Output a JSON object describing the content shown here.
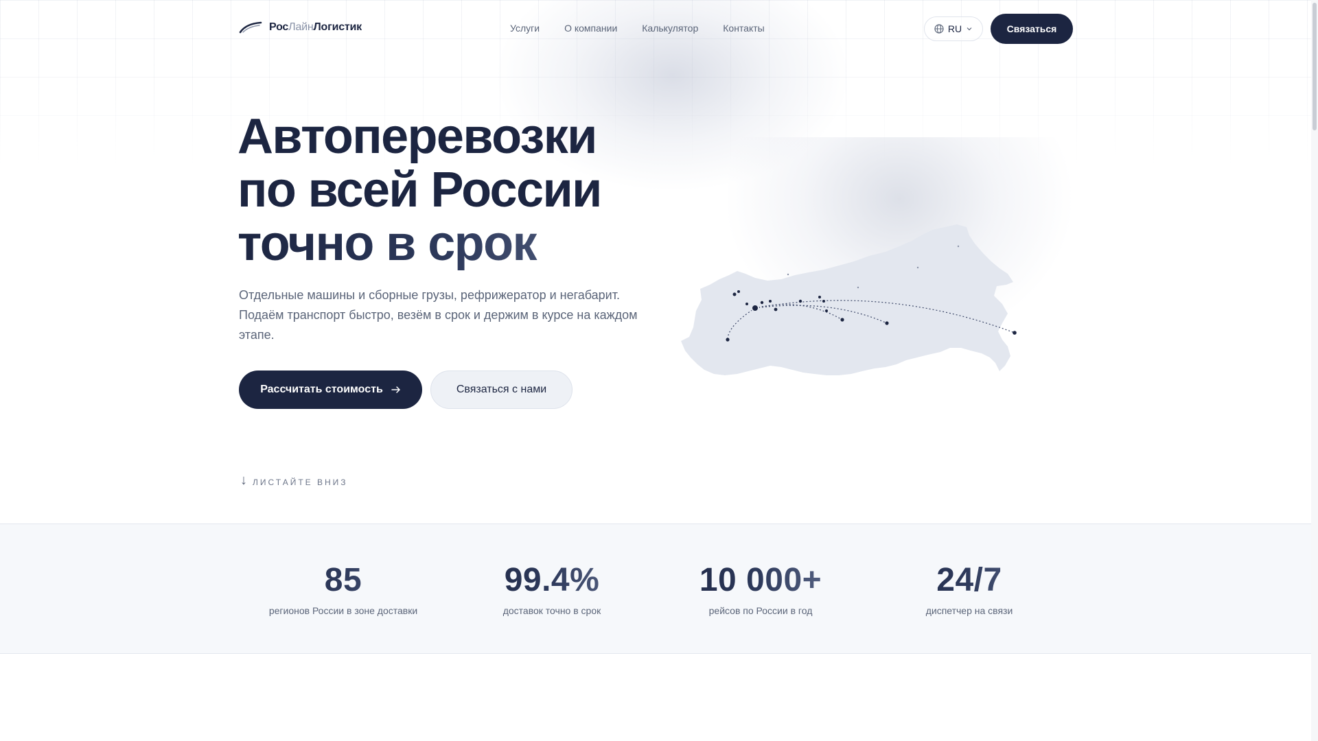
{
  "logo": {
    "part1": "Рос",
    "part2": "Лайн",
    "part3": "Логистик"
  },
  "nav": {
    "items": [
      {
        "label": "Услуги"
      },
      {
        "label": "О компании"
      },
      {
        "label": "Калькулятор"
      },
      {
        "label": "Контакты"
      }
    ]
  },
  "header": {
    "lang": "RU",
    "lang_icon": "globe-icon",
    "cta": "Связаться"
  },
  "hero": {
    "title_line1": "Автоперевозки",
    "title_line2": "по всей России",
    "title_line3": "точно в срок",
    "subtitle": "Отдельные машины и сборные грузы, рефрижератор и негабарит. Подаём транспорт быстро, везём в срок и держим в курсе на каждом этапе.",
    "btn_primary": "Рассчитать стоимость",
    "btn_secondary": "Связаться с нами",
    "scroll_label": "ЛИСТАЙТЕ ВНИЗ"
  },
  "stats": [
    {
      "value": "85",
      "label": "регионов России в зоне доставки"
    },
    {
      "value": "99.4%",
      "label": "доставок точно в срок"
    },
    {
      "value": "10 000+",
      "label": "рейсов по России в год"
    },
    {
      "value": "24/7",
      "label": "диспетчер на связи"
    }
  ],
  "colors": {
    "brand": "#1c2541",
    "muted": "#5a6478",
    "map_fill": "#e3e7ef",
    "stats_bg": "#f6f8fb"
  }
}
